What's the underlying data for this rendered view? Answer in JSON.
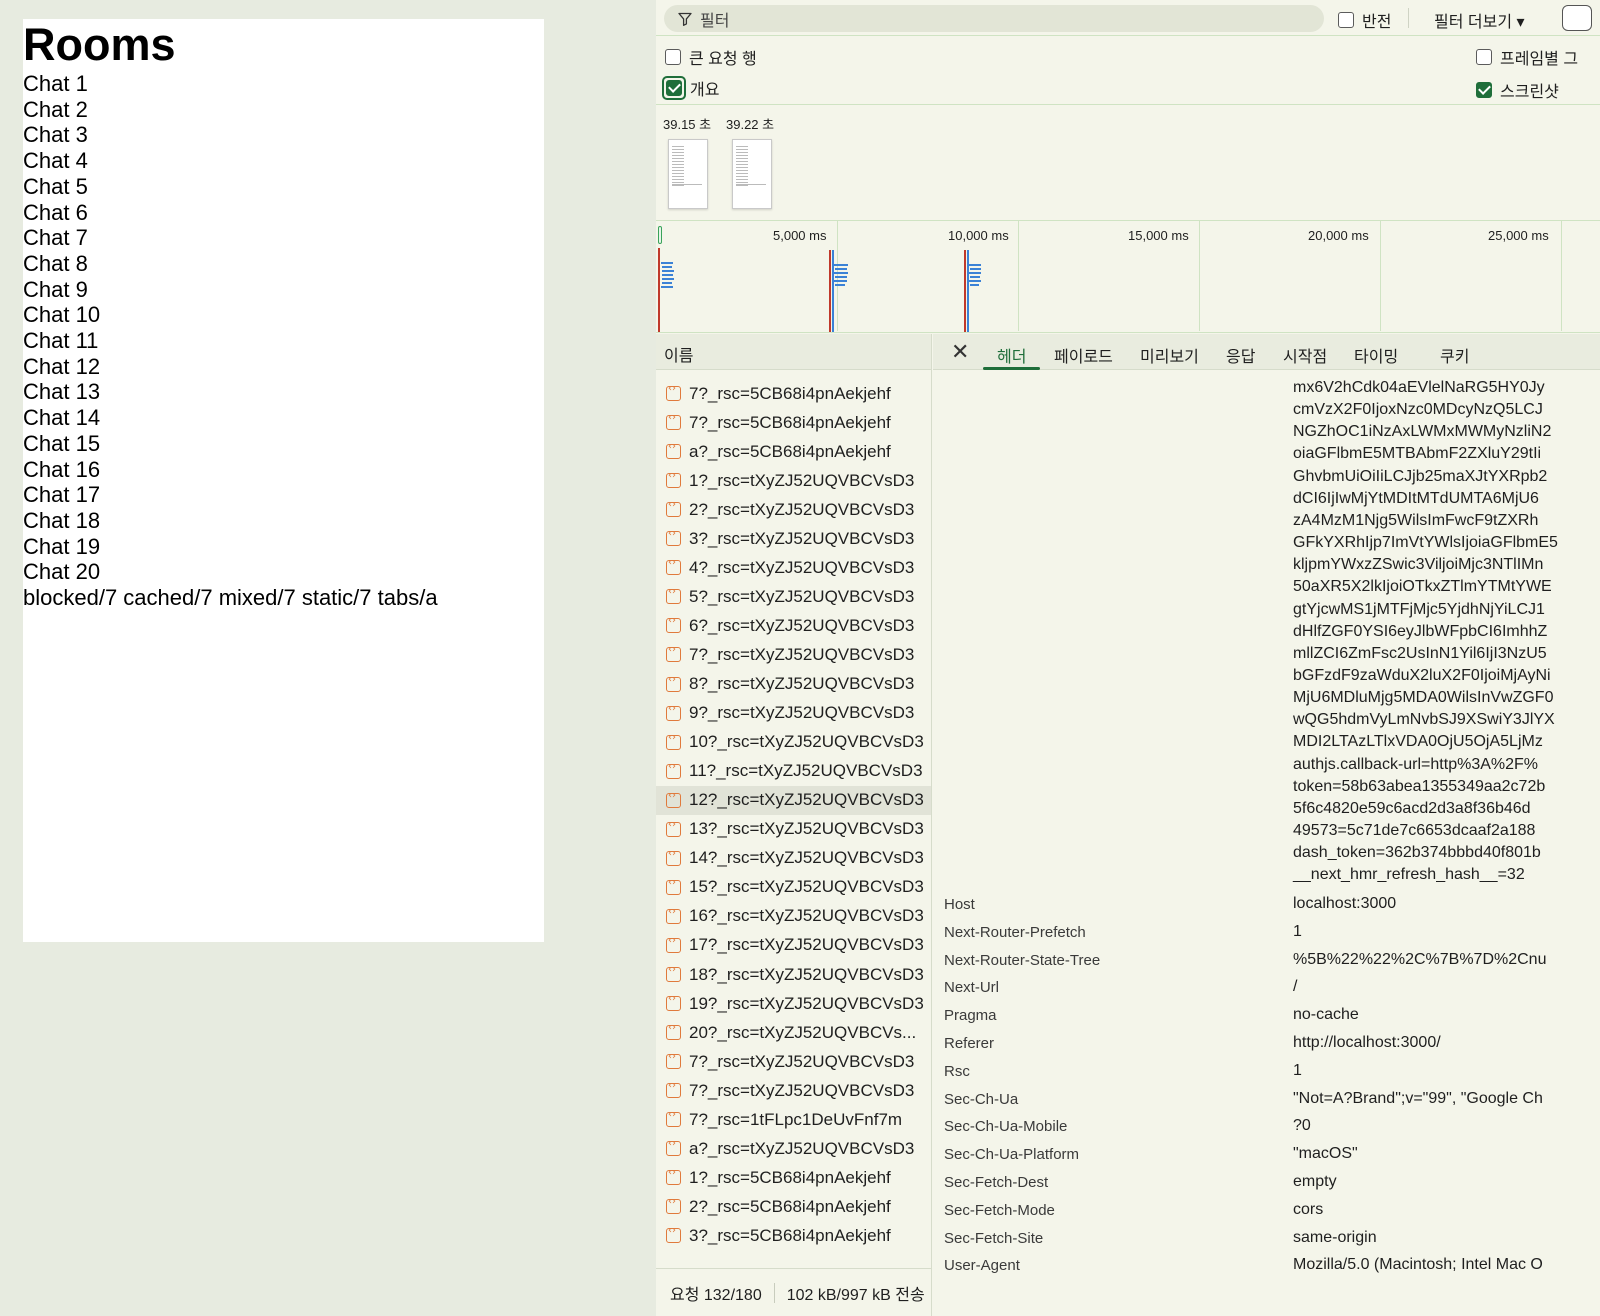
{
  "page": {
    "title": "Rooms",
    "chats": [
      "Chat 1",
      "Chat 2",
      "Chat 3",
      "Chat 4",
      "Chat 5",
      "Chat 6",
      "Chat 7",
      "Chat 8",
      "Chat 9",
      "Chat 10",
      "Chat 11",
      "Chat 12",
      "Chat 13",
      "Chat 14",
      "Chat 15",
      "Chat 16",
      "Chat 17",
      "Chat 18",
      "Chat 19",
      "Chat 20"
    ],
    "footer_links": "blocked/7 cached/7 mixed/7 static/7 tabs/a"
  },
  "devtools": {
    "filter_placeholder": "필터",
    "invert_label": "반전",
    "more_filters_label": "필터 더보기 ▾",
    "large_rows_label": "큰 요청 행",
    "frame_group_label": "프레임별 그",
    "overview_label": "개요",
    "screenshot_label": "스크린샷",
    "screenshot_times": [
      "39.15 초",
      "39.22 초"
    ],
    "timeline_labels": [
      "5,000 ms",
      "10,000 ms",
      "15,000 ms",
      "20,000 ms",
      "25,000 ms"
    ],
    "name_header": "이름",
    "requests": [
      "7?_rsc=5CB68i4pnAekjehf",
      "7?_rsc=5CB68i4pnAekjehf",
      "a?_rsc=5CB68i4pnAekjehf",
      "1?_rsc=tXyZJ52UQVBCVsD3",
      "2?_rsc=tXyZJ52UQVBCVsD3",
      "3?_rsc=tXyZJ52UQVBCVsD3",
      "4?_rsc=tXyZJ52UQVBCVsD3",
      "5?_rsc=tXyZJ52UQVBCVsD3",
      "6?_rsc=tXyZJ52UQVBCVsD3",
      "7?_rsc=tXyZJ52UQVBCVsD3",
      "8?_rsc=tXyZJ52UQVBCVsD3",
      "9?_rsc=tXyZJ52UQVBCVsD3",
      "10?_rsc=tXyZJ52UQVBCVsD3",
      "11?_rsc=tXyZJ52UQVBCVsD3",
      "12?_rsc=tXyZJ52UQVBCVsD3",
      "13?_rsc=tXyZJ52UQVBCVsD3",
      "14?_rsc=tXyZJ52UQVBCVsD3",
      "15?_rsc=tXyZJ52UQVBCVsD3",
      "16?_rsc=tXyZJ52UQVBCVsD3",
      "17?_rsc=tXyZJ52UQVBCVsD3",
      "18?_rsc=tXyZJ52UQVBCVsD3",
      "19?_rsc=tXyZJ52UQVBCVsD3",
      "20?_rsc=tXyZJ52UQVBCVs...",
      "7?_rsc=tXyZJ52UQVBCVsD3",
      "7?_rsc=tXyZJ52UQVBCVsD3",
      "7?_rsc=1tFLpc1DeUvFnf7m",
      "a?_rsc=tXyZJ52UQVBCVsD3",
      "1?_rsc=5CB68i4pnAekjehf",
      "2?_rsc=5CB68i4pnAekjehf",
      "3?_rsc=5CB68i4pnAekjehf"
    ],
    "selected_request_index": 14,
    "status_requests": "요청 132/180",
    "status_transferred": "102 kB/997 kB 전송",
    "tabs": [
      "헤더",
      "페이로드",
      "미리보기",
      "응답",
      "시작점",
      "타이밍",
      "쿠키"
    ],
    "active_tab": "헤더",
    "cookie_lines": [
      "mx6V2hCdk04aEVlelNaRG5HY0Jy",
      "cmVzX2F0IjoxNzc0MDcyNzQ5LCJ",
      "NGZhOC1iNzAxLWMxMWMyNzliN2",
      "oiaGFlbmE5MTBAbmF2ZXluY29tIi",
      "GhvbmUiOiIiLCJjb25maXJtYXRpb2",
      "dCI6IjIwMjYtMDItMTdUMTA6MjU6",
      "zA4MzM1Njg5WilsImFwcF9tZXRh",
      "GFkYXRhIjp7ImVtYWlsIjoiaGFlbmE5",
      "kljpmYWxzZSwic3ViljoiMjc3NTlIMn",
      "50aXR5X2lkIjoiOTkxZTlmYTMtYWE",
      "gtYjcwMS1jMTFjMjc5YjdhNjYiLCJ1",
      "dHlfZGF0YSI6eyJlbWFpbCI6ImhhZ",
      "mllZCI6ZmFsc2UsInN1Yil6IjI3NzU5",
      "bGFzdF9zaWduX2luX2F0IjoiMjAyNi",
      "MjU6MDluMjg5MDA0WilsInVwZGF0",
      "wQG5hdmVyLmNvbSJ9XSwiY3JlYX",
      "MDI2LTAzLTlxVDA0OjU5OjA5LjMz",
      "authjs.callback-url=http%3A%2F%",
      "token=58b63abea1355349aa2c72b",
      "5f6c4820e59c6acd2d3a8f36b46d",
      "49573=5c71de7c6653dcaaf2a188",
      "dash_token=362b374bbbd40f801b",
      "__next_hmr_refresh_hash__=32"
    ],
    "headers": [
      {
        "key": "Host",
        "value": "localhost:3000"
      },
      {
        "key": "Next-Router-Prefetch",
        "value": "1"
      },
      {
        "key": "Next-Router-State-Tree",
        "value": "%5B%22%22%2C%7B%7D%2Cnu"
      },
      {
        "key": "Next-Url",
        "value": "/"
      },
      {
        "key": "Pragma",
        "value": "no-cache"
      },
      {
        "key": "Referer",
        "value": "http://localhost:3000/"
      },
      {
        "key": "Rsc",
        "value": "1"
      },
      {
        "key": "Sec-Ch-Ua",
        "value": "\"Not=A?Brand\";v=\"99\", \"Google Ch"
      },
      {
        "key": "Sec-Ch-Ua-Mobile",
        "value": "?0"
      },
      {
        "key": "Sec-Ch-Ua-Platform",
        "value": "\"macOS\""
      },
      {
        "key": "Sec-Fetch-Dest",
        "value": "empty"
      },
      {
        "key": "Sec-Fetch-Mode",
        "value": "cors"
      },
      {
        "key": "Sec-Fetch-Site",
        "value": "same-origin"
      },
      {
        "key": "User-Agent",
        "value": "Mozilla/5.0 (Macintosh; Intel Mac O"
      }
    ]
  },
  "colors": {
    "accent_green": "#1f6e3a",
    "request_icon_orange": "#e07a3c",
    "timeline_blue": "#3b82d6",
    "timeline_red": "#c0392b"
  }
}
